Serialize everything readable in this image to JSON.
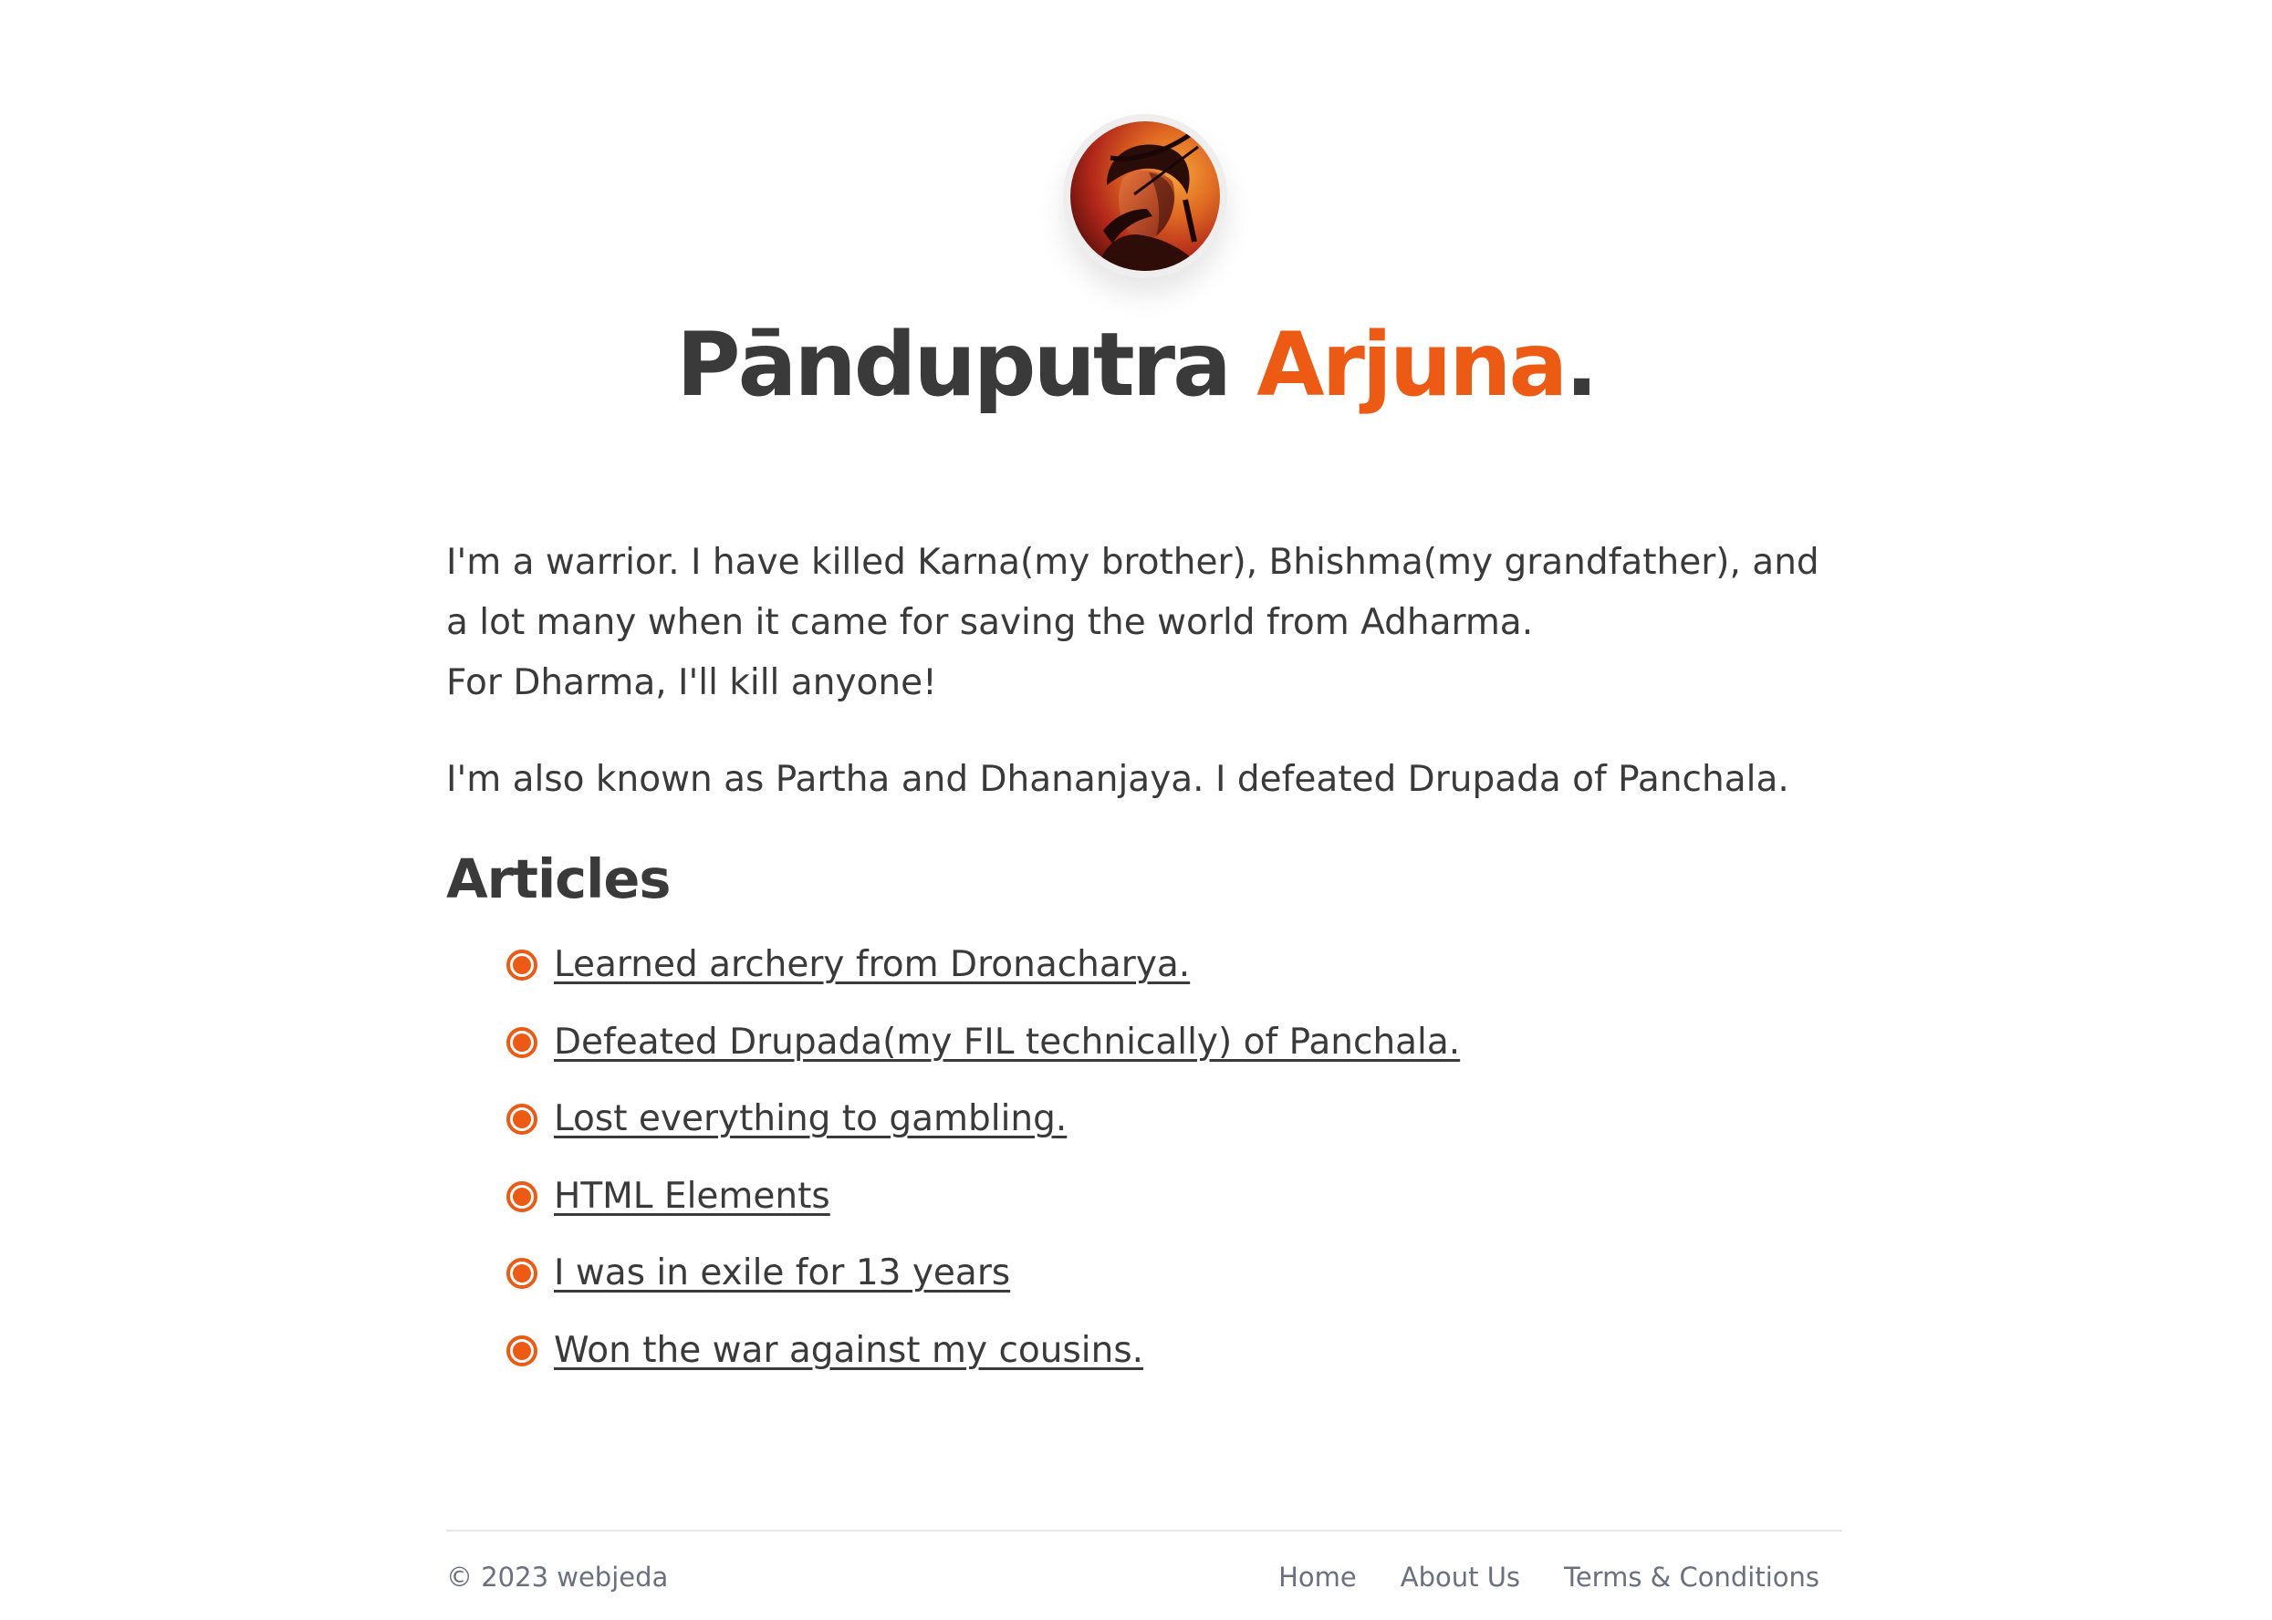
{
  "header": {
    "title_main": "Pānduputra ",
    "title_accent": "Arjuna",
    "title_end": "."
  },
  "avatar": {
    "icon": "archer-portrait-icon"
  },
  "intro": {
    "line1": "I'm a warrior. I have killed Karna(my brother), Bhishma(my grandfather), and a lot many when it came for saving the world from Adharma.",
    "line2": "For Dharma, I'll kill anyone!",
    "line3": "I'm also known as Partha and Dhananjaya. I defeated Drupada of Panchala."
  },
  "articles": {
    "heading": "Articles",
    "items": [
      {
        "label": "Learned archery from Dronacharya."
      },
      {
        "label": "Defeated Drupada(my FIL technically) of Panchala."
      },
      {
        "label": "Lost everything to gambling."
      },
      {
        "label": "HTML Elements"
      },
      {
        "label": "I was in exile for 13 years"
      },
      {
        "label": "Won the war against my cousins."
      }
    ]
  },
  "footer": {
    "copyright": "© 2023 webjeda",
    "links": [
      {
        "label": "Home"
      },
      {
        "label": "About Us"
      },
      {
        "label": "Terms & Conditions"
      }
    ]
  },
  "colors": {
    "accent": "#ec5a13",
    "text": "#3a3a3a",
    "muted": "#6b6f80"
  }
}
